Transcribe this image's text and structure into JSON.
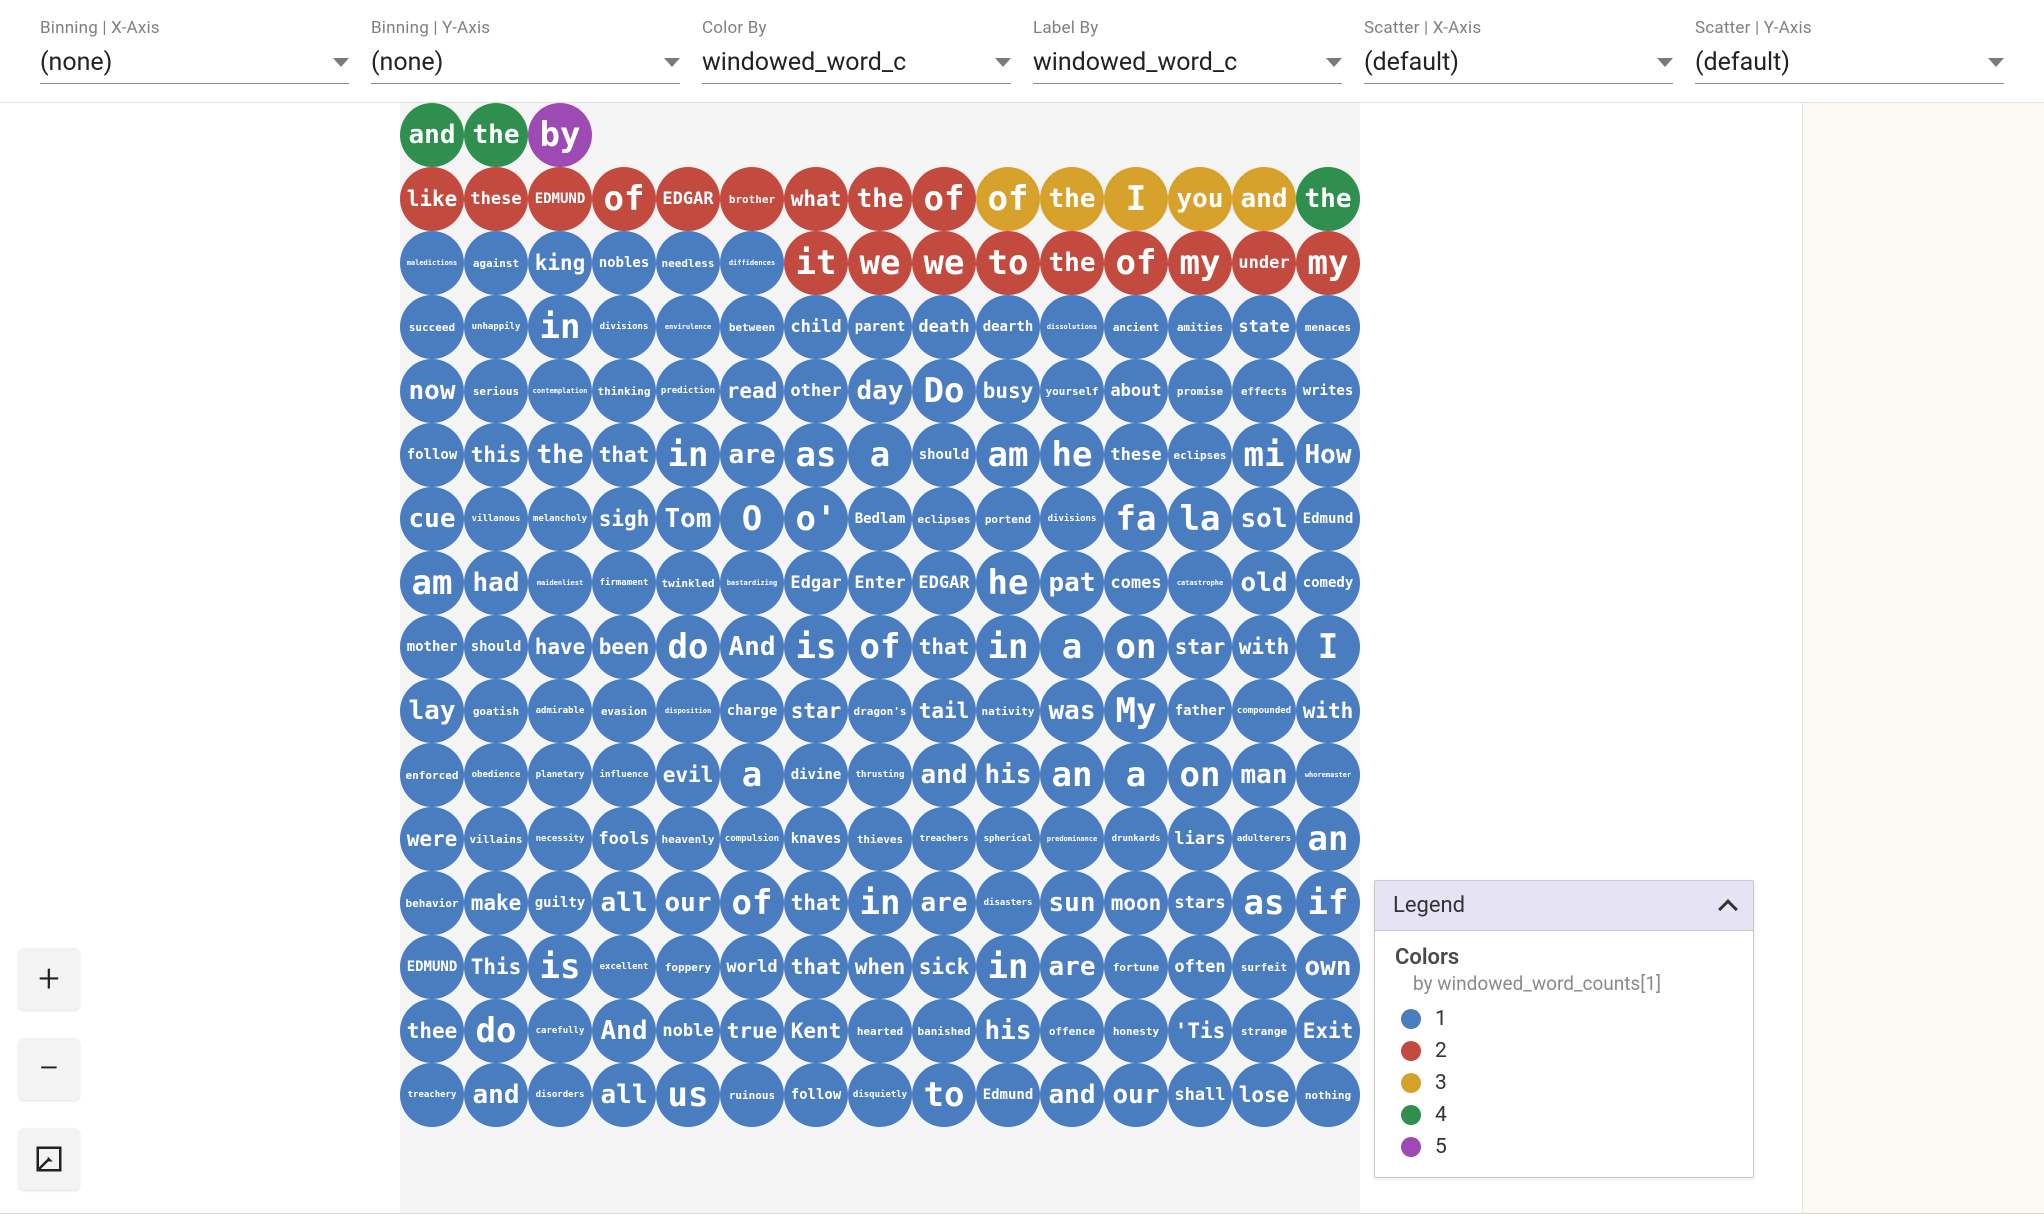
{
  "toolbar": {
    "dropdowns": [
      {
        "label": "Binning | X-Axis",
        "value": "(none)"
      },
      {
        "label": "Binning | Y-Axis",
        "value": "(none)"
      },
      {
        "label": "Color By",
        "value": "windowed_word_c"
      },
      {
        "label": "Label By",
        "value": "windowed_word_c"
      },
      {
        "label": "Scatter | X-Axis",
        "value": "(default)"
      },
      {
        "label": "Scatter | Y-Axis",
        "value": "(default)"
      }
    ]
  },
  "colors": {
    "1": "#4a7dc0",
    "2": "#c24a3f",
    "3": "#d7a22c",
    "4": "#2f8f4e",
    "5": "#9d4ab4"
  },
  "grid": [
    [
      {
        "t": "and",
        "c": 4
      },
      {
        "t": "the",
        "c": 4
      },
      {
        "t": "by",
        "c": 5
      }
    ],
    [
      {
        "t": "like",
        "c": 2
      },
      {
        "t": "these",
        "c": 2
      },
      {
        "t": "EDMUND",
        "c": 2
      },
      {
        "t": "of",
        "c": 2
      },
      {
        "t": "EDGAR",
        "c": 2
      },
      {
        "t": "brother",
        "c": 2
      },
      {
        "t": "what",
        "c": 2
      },
      {
        "t": "the",
        "c": 2
      },
      {
        "t": "of",
        "c": 2
      },
      {
        "t": "of",
        "c": 3
      },
      {
        "t": "the",
        "c": 3
      },
      {
        "t": "I",
        "c": 3
      },
      {
        "t": "you",
        "c": 3
      },
      {
        "t": "and",
        "c": 3
      },
      {
        "t": "the",
        "c": 4
      }
    ],
    [
      {
        "t": "maledictions",
        "c": 1
      },
      {
        "t": "against",
        "c": 1
      },
      {
        "t": "king",
        "c": 1
      },
      {
        "t": "nobles",
        "c": 1
      },
      {
        "t": "needless",
        "c": 1
      },
      {
        "t": "diffidences",
        "c": 1
      },
      {
        "t": "it",
        "c": 2
      },
      {
        "t": "we",
        "c": 2
      },
      {
        "t": "we",
        "c": 2
      },
      {
        "t": "to",
        "c": 2
      },
      {
        "t": "the",
        "c": 2
      },
      {
        "t": "of",
        "c": 2
      },
      {
        "t": "my",
        "c": 2
      },
      {
        "t": "under",
        "c": 2
      },
      {
        "t": "my",
        "c": 2
      }
    ],
    [
      {
        "t": "succeed",
        "c": 1
      },
      {
        "t": "unhappily",
        "c": 1
      },
      {
        "t": "in",
        "c": 1
      },
      {
        "t": "divisions",
        "c": 1
      },
      {
        "t": "envirulence",
        "c": 1
      },
      {
        "t": "between",
        "c": 1
      },
      {
        "t": "child",
        "c": 1
      },
      {
        "t": "parent",
        "c": 1
      },
      {
        "t": "death",
        "c": 1
      },
      {
        "t": "dearth",
        "c": 1
      },
      {
        "t": "dissolutions",
        "c": 1
      },
      {
        "t": "ancient",
        "c": 1
      },
      {
        "t": "amities",
        "c": 1
      },
      {
        "t": "state",
        "c": 1
      },
      {
        "t": "menaces",
        "c": 1
      }
    ],
    [
      {
        "t": "now",
        "c": 1
      },
      {
        "t": "serious",
        "c": 1
      },
      {
        "t": "contemplation",
        "c": 1
      },
      {
        "t": "thinking",
        "c": 1
      },
      {
        "t": "prediction",
        "c": 1
      },
      {
        "t": "read",
        "c": 1
      },
      {
        "t": "other",
        "c": 1
      },
      {
        "t": "day",
        "c": 1
      },
      {
        "t": "Do",
        "c": 1
      },
      {
        "t": "busy",
        "c": 1
      },
      {
        "t": "yourself",
        "c": 1
      },
      {
        "t": "about",
        "c": 1
      },
      {
        "t": "promise",
        "c": 1
      },
      {
        "t": "effects",
        "c": 1
      },
      {
        "t": "writes",
        "c": 1
      }
    ],
    [
      {
        "t": "follow",
        "c": 1
      },
      {
        "t": "this",
        "c": 1
      },
      {
        "t": "the",
        "c": 1
      },
      {
        "t": "that",
        "c": 1
      },
      {
        "t": "in",
        "c": 1
      },
      {
        "t": "are",
        "c": 1
      },
      {
        "t": "as",
        "c": 1
      },
      {
        "t": "a",
        "c": 1
      },
      {
        "t": "should",
        "c": 1
      },
      {
        "t": "am",
        "c": 1
      },
      {
        "t": "he",
        "c": 1
      },
      {
        "t": "these",
        "c": 1
      },
      {
        "t": "eclipses",
        "c": 1
      },
      {
        "t": "mi",
        "c": 1
      },
      {
        "t": "How",
        "c": 1
      }
    ],
    [
      {
        "t": "cue",
        "c": 1
      },
      {
        "t": "villanous",
        "c": 1
      },
      {
        "t": "melancholy",
        "c": 1
      },
      {
        "t": "sigh",
        "c": 1
      },
      {
        "t": "Tom",
        "c": 1
      },
      {
        "t": "O",
        "c": 1
      },
      {
        "t": "o'",
        "c": 1
      },
      {
        "t": "Bedlam",
        "c": 1
      },
      {
        "t": "eclipses",
        "c": 1
      },
      {
        "t": "portend",
        "c": 1
      },
      {
        "t": "divisions",
        "c": 1
      },
      {
        "t": "fa",
        "c": 1
      },
      {
        "t": "la",
        "c": 1
      },
      {
        "t": "sol",
        "c": 1
      },
      {
        "t": "Edmund",
        "c": 1
      }
    ],
    [
      {
        "t": "am",
        "c": 1
      },
      {
        "t": "had",
        "c": 1
      },
      {
        "t": "maidenliest",
        "c": 1
      },
      {
        "t": "firmament",
        "c": 1
      },
      {
        "t": "twinkled",
        "c": 1
      },
      {
        "t": "bastardizing",
        "c": 1
      },
      {
        "t": "Edgar",
        "c": 1
      },
      {
        "t": "Enter",
        "c": 1
      },
      {
        "t": "EDGAR",
        "c": 1
      },
      {
        "t": "he",
        "c": 1
      },
      {
        "t": "pat",
        "c": 1
      },
      {
        "t": "comes",
        "c": 1
      },
      {
        "t": "catastrophe",
        "c": 1
      },
      {
        "t": "old",
        "c": 1
      },
      {
        "t": "comedy",
        "c": 1
      }
    ],
    [
      {
        "t": "mother",
        "c": 1
      },
      {
        "t": "should",
        "c": 1
      },
      {
        "t": "have",
        "c": 1
      },
      {
        "t": "been",
        "c": 1
      },
      {
        "t": "do",
        "c": 1
      },
      {
        "t": "And",
        "c": 1
      },
      {
        "t": "is",
        "c": 1
      },
      {
        "t": "of",
        "c": 1
      },
      {
        "t": "that",
        "c": 1
      },
      {
        "t": "in",
        "c": 1
      },
      {
        "t": "a",
        "c": 1
      },
      {
        "t": "on",
        "c": 1
      },
      {
        "t": "star",
        "c": 1
      },
      {
        "t": "with",
        "c": 1
      },
      {
        "t": "I",
        "c": 1
      }
    ],
    [
      {
        "t": "lay",
        "c": 1
      },
      {
        "t": "goatish",
        "c": 1
      },
      {
        "t": "admirable",
        "c": 1
      },
      {
        "t": "evasion",
        "c": 1
      },
      {
        "t": "disposition",
        "c": 1
      },
      {
        "t": "charge",
        "c": 1
      },
      {
        "t": "star",
        "c": 1
      },
      {
        "t": "dragon's",
        "c": 1
      },
      {
        "t": "tail",
        "c": 1
      },
      {
        "t": "nativity",
        "c": 1
      },
      {
        "t": "was",
        "c": 1
      },
      {
        "t": "My",
        "c": 1
      },
      {
        "t": "father",
        "c": 1
      },
      {
        "t": "compounded",
        "c": 1
      },
      {
        "t": "with",
        "c": 1
      }
    ],
    [
      {
        "t": "enforced",
        "c": 1
      },
      {
        "t": "obedience",
        "c": 1
      },
      {
        "t": "planetary",
        "c": 1
      },
      {
        "t": "influence",
        "c": 1
      },
      {
        "t": "evil",
        "c": 1
      },
      {
        "t": "a",
        "c": 1
      },
      {
        "t": "divine",
        "c": 1
      },
      {
        "t": "thrusting",
        "c": 1
      },
      {
        "t": "and",
        "c": 1
      },
      {
        "t": "his",
        "c": 1
      },
      {
        "t": "an",
        "c": 1
      },
      {
        "t": "a",
        "c": 1
      },
      {
        "t": "on",
        "c": 1
      },
      {
        "t": "man",
        "c": 1
      },
      {
        "t": "whoremaster",
        "c": 1
      }
    ],
    [
      {
        "t": "were",
        "c": 1
      },
      {
        "t": "villains",
        "c": 1
      },
      {
        "t": "necessity",
        "c": 1
      },
      {
        "t": "fools",
        "c": 1
      },
      {
        "t": "heavenly",
        "c": 1
      },
      {
        "t": "compulsion",
        "c": 1
      },
      {
        "t": "knaves",
        "c": 1
      },
      {
        "t": "thieves",
        "c": 1
      },
      {
        "t": "treachers",
        "c": 1
      },
      {
        "t": "spherical",
        "c": 1
      },
      {
        "t": "predominance",
        "c": 1
      },
      {
        "t": "drunkards",
        "c": 1
      },
      {
        "t": "liars",
        "c": 1
      },
      {
        "t": "adulterers",
        "c": 1
      },
      {
        "t": "an",
        "c": 1
      }
    ],
    [
      {
        "t": "behavior",
        "c": 1
      },
      {
        "t": "make",
        "c": 1
      },
      {
        "t": "guilty",
        "c": 1
      },
      {
        "t": "all",
        "c": 1
      },
      {
        "t": "our",
        "c": 1
      },
      {
        "t": "of",
        "c": 1
      },
      {
        "t": "that",
        "c": 1
      },
      {
        "t": "in",
        "c": 1
      },
      {
        "t": "are",
        "c": 1
      },
      {
        "t": "disasters",
        "c": 1
      },
      {
        "t": "sun",
        "c": 1
      },
      {
        "t": "moon",
        "c": 1
      },
      {
        "t": "stars",
        "c": 1
      },
      {
        "t": "as",
        "c": 1
      },
      {
        "t": "if",
        "c": 1
      }
    ],
    [
      {
        "t": "EDMUND",
        "c": 1
      },
      {
        "t": "This",
        "c": 1
      },
      {
        "t": "is",
        "c": 1
      },
      {
        "t": "excellent",
        "c": 1
      },
      {
        "t": "foppery",
        "c": 1
      },
      {
        "t": "world",
        "c": 1
      },
      {
        "t": "that",
        "c": 1
      },
      {
        "t": "when",
        "c": 1
      },
      {
        "t": "sick",
        "c": 1
      },
      {
        "t": "in",
        "c": 1
      },
      {
        "t": "are",
        "c": 1
      },
      {
        "t": "fortune",
        "c": 1
      },
      {
        "t": "often",
        "c": 1
      },
      {
        "t": "surfeit",
        "c": 1
      },
      {
        "t": "own",
        "c": 1
      }
    ],
    [
      {
        "t": "thee",
        "c": 1
      },
      {
        "t": "do",
        "c": 1
      },
      {
        "t": "carefully",
        "c": 1
      },
      {
        "t": "And",
        "c": 1
      },
      {
        "t": "noble",
        "c": 1
      },
      {
        "t": "true",
        "c": 1
      },
      {
        "t": "Kent",
        "c": 1
      },
      {
        "t": "hearted",
        "c": 1
      },
      {
        "t": "banished",
        "c": 1
      },
      {
        "t": "his",
        "c": 1
      },
      {
        "t": "offence",
        "c": 1
      },
      {
        "t": "honesty",
        "c": 1
      },
      {
        "t": "'Tis",
        "c": 1
      },
      {
        "t": "strange",
        "c": 1
      },
      {
        "t": "Exit",
        "c": 1
      }
    ],
    [
      {
        "t": "treachery",
        "c": 1
      },
      {
        "t": "and",
        "c": 1
      },
      {
        "t": "disorders",
        "c": 1
      },
      {
        "t": "all",
        "c": 1
      },
      {
        "t": "us",
        "c": 1
      },
      {
        "t": "ruinous",
        "c": 1
      },
      {
        "t": "follow",
        "c": 1
      },
      {
        "t": "disquietly",
        "c": 1
      },
      {
        "t": "to",
        "c": 1
      },
      {
        "t": "Edmund",
        "c": 1
      },
      {
        "t": "and",
        "c": 1
      },
      {
        "t": "our",
        "c": 1
      },
      {
        "t": "shall",
        "c": 1
      },
      {
        "t": "lose",
        "c": 1
      },
      {
        "t": "nothing",
        "c": 1
      }
    ]
  ],
  "legend": {
    "title": "Legend",
    "section": "Colors",
    "sub": "by windowed_word_counts[1]",
    "items": [
      {
        "label": "1",
        "color": "#4a7dc0"
      },
      {
        "label": "2",
        "color": "#c24a3f"
      },
      {
        "label": "3",
        "color": "#d7a22c"
      },
      {
        "label": "4",
        "color": "#2f8f4e"
      },
      {
        "label": "5",
        "color": "#9d4ab4"
      }
    ]
  },
  "zoom": {
    "in": "+",
    "out": "−"
  }
}
